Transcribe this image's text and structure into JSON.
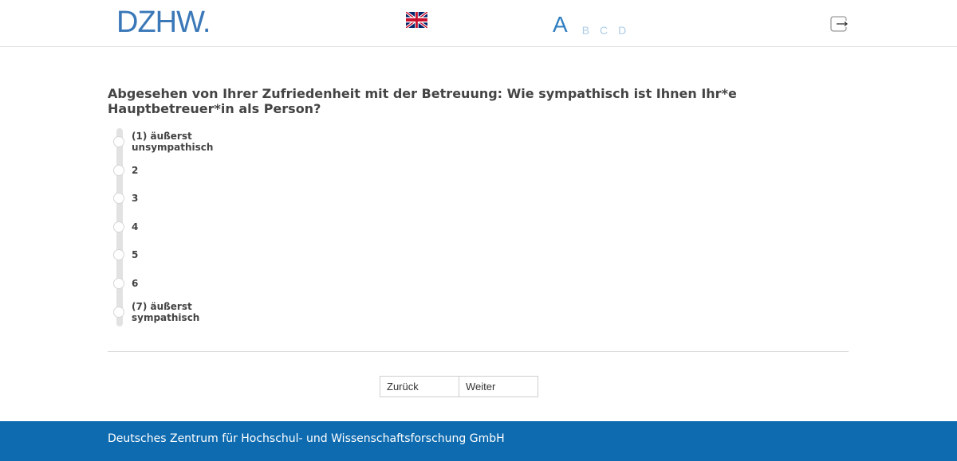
{
  "header": {
    "logo_text": "DZHW.",
    "language_flag": "uk-flag-icon",
    "font_sizes": [
      "A",
      "B",
      "C",
      "D"
    ],
    "active_font_size": "A",
    "logout_icon": "logout-icon"
  },
  "question": {
    "text": "Abgesehen von Ihrer Zufriedenheit mit der Betreuung: Wie sympathisch ist Ihnen Ihr*e Hauptbetreuer*in als Person?",
    "options": [
      {
        "label": "(1) äußerst unsympathisch"
      },
      {
        "label": "2"
      },
      {
        "label": "3"
      },
      {
        "label": "4"
      },
      {
        "label": "5"
      },
      {
        "label": "6"
      },
      {
        "label": "(7) äußerst sympathisch"
      }
    ]
  },
  "navigation": {
    "back_label": "Zurück",
    "next_label": "Weiter"
  },
  "footer": {
    "text": "Deutsches Zentrum für Hochschul- und Wissenschaftsforschung GmbH"
  },
  "colors": {
    "brand_blue": "#0e6bb0",
    "logo_blue": "#3a78b8",
    "font_switch_active": "#2f7ec0",
    "font_switch_inactive": "#aecde6"
  }
}
